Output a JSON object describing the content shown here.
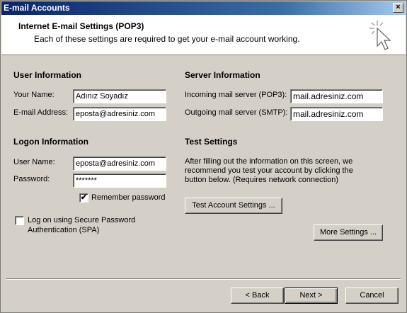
{
  "window": {
    "title": "E-mail Accounts",
    "close_glyph": "×"
  },
  "header": {
    "title": "Internet E-mail Settings (POP3)",
    "subtitle": "Each of these settings are required to get your e-mail account working."
  },
  "user_info": {
    "heading": "User Information",
    "name_label": "Your Name:",
    "name_value": "Adınız Soyadız",
    "email_label": "E-mail Address:",
    "email_value": "eposta@adresiniz.com"
  },
  "logon_info": {
    "heading": "Logon Information",
    "username_label": "User Name:",
    "username_value": "eposta@adresiniz.com",
    "password_label": "Password:",
    "password_value": "*******",
    "remember_label": "Remember password",
    "remember_checked": true,
    "remember_mark": "✔",
    "spa_label_line1": "Log on using Secure Password",
    "spa_label_line2": "Authentication (SPA)",
    "spa_checked": false
  },
  "server_info": {
    "heading": "Server Information",
    "incoming_label": "Incoming mail server (POP3):",
    "incoming_value": "mail.adresiniz.com",
    "outgoing_label": "Outgoing mail server (SMTP):",
    "outgoing_value": "mail.adresiniz.com"
  },
  "test_settings": {
    "heading": "Test Settings",
    "line1": "After filling out the information on this screen, we",
    "line2": "recommend you test your account by clicking the",
    "line3": "button below. (Requires network connection)",
    "test_button": "Test Account Settings ...",
    "more_button": "More Settings ..."
  },
  "footer": {
    "back_button": "< Back",
    "next_button": "Next >",
    "cancel_button": "Cancel"
  },
  "icons": {
    "header_icon": "wizard-cursor-icon"
  }
}
